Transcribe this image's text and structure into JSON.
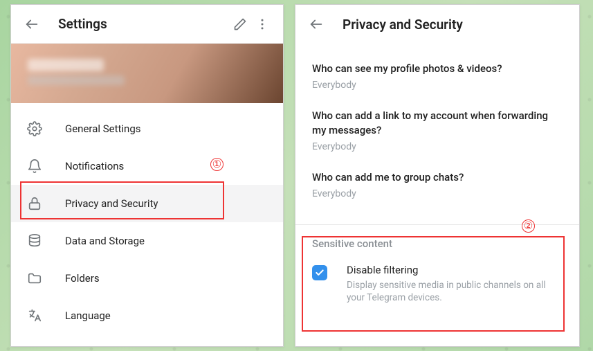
{
  "left": {
    "title": "Settings",
    "menu": [
      {
        "label": "General Settings"
      },
      {
        "label": "Notifications"
      },
      {
        "label": "Privacy and Security"
      },
      {
        "label": "Data and Storage"
      },
      {
        "label": "Folders"
      },
      {
        "label": "Language"
      }
    ]
  },
  "right": {
    "title": "Privacy and Security",
    "items": [
      {
        "q": "Who can see my profile photos & videos?",
        "v": "Everybody"
      },
      {
        "q": "Who can add a link to my account when forwarding my messages?",
        "v": "Everybody"
      },
      {
        "q": "Who can add me to group chats?",
        "v": "Everybody"
      }
    ],
    "sensitive": {
      "section": "Sensitive content",
      "title": "Disable filtering",
      "sub": "Display sensitive media in public channels on all your Telegram devices.",
      "checked": true
    }
  },
  "annotations": {
    "one": "①",
    "two": "②"
  }
}
